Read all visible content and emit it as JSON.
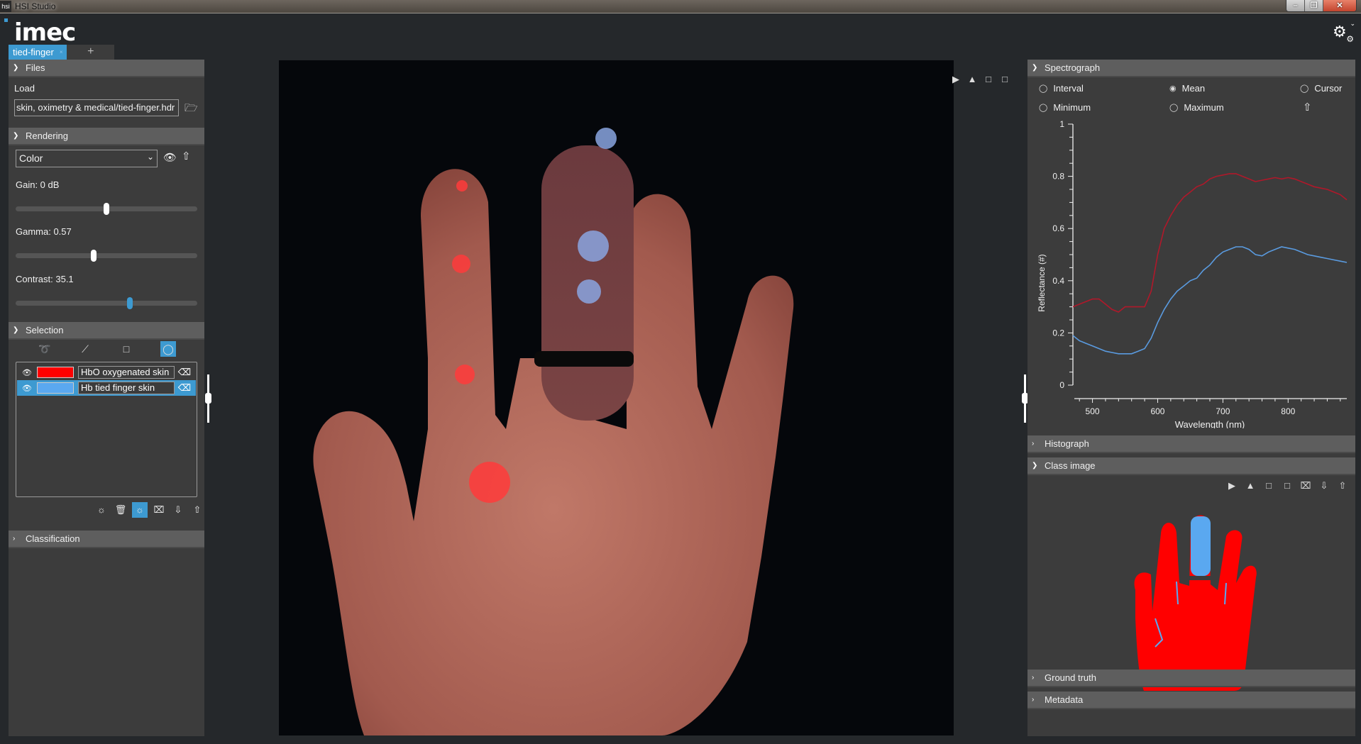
{
  "window": {
    "app_icon": "hsi",
    "title": "HSI Studio",
    "buttons": [
      "minimize",
      "maximize",
      "close"
    ]
  },
  "logo": "imec",
  "tabs": [
    {
      "label": "tied-finger",
      "close": "×",
      "active": true
    }
  ],
  "tab_add": "+",
  "files": {
    "header": "Files",
    "load_label": "Load",
    "path": "skin, oximetry & medical/tied-finger.hdr"
  },
  "rendering": {
    "header": "Rendering",
    "mode": "Color",
    "gain_label": "Gain: 0 dB",
    "gain_fraction": 0.5,
    "gamma_label": "Gamma: 0.57",
    "gamma_fraction": 0.43,
    "contrast_label": "Contrast: 35.1",
    "contrast_fraction": 0.63
  },
  "selection": {
    "header": "Selection",
    "tools": [
      "lasso",
      "line",
      "rectangle",
      "ellipse"
    ],
    "active_tool": "ellipse",
    "classes": [
      {
        "name": "HbO oxygenated skin",
        "color": "#ff0000",
        "visible": true,
        "selected": false
      },
      {
        "name": "Hb tied finger skin",
        "color": "#5aa8f0",
        "visible": true,
        "selected": true
      }
    ],
    "actions": [
      "mask-overlay",
      "delete",
      "mask-overlay-active",
      "clear",
      "import",
      "export"
    ]
  },
  "classification": {
    "header": "Classification"
  },
  "viewer": {
    "tools": [
      "flip-vertical",
      "flip-horizontal",
      "rotate-right",
      "rotate-left"
    ],
    "overlays": {
      "red": "#ff3b3b",
      "blue": "#8aa4e0"
    }
  },
  "spectrograph": {
    "header": "Spectrograph",
    "options": [
      {
        "label": "Interval",
        "visible": false
      },
      {
        "label": "Mean",
        "visible": true
      },
      {
        "label": "Cursor",
        "visible": false
      },
      {
        "label": "Minimum",
        "visible": false
      },
      {
        "label": "Maximum",
        "visible": false
      }
    ]
  },
  "chart_data": {
    "type": "line",
    "title": "",
    "xlabel": "Wavelength (nm)",
    "ylabel": "Reflectance (#)",
    "xlim": [
      470,
      890
    ],
    "ylim": [
      0,
      1
    ],
    "xticks": [
      500,
      600,
      700,
      800
    ],
    "yticks": [
      0,
      0.2,
      0.4,
      0.6,
      0.8,
      1
    ],
    "ytick_labels": [
      "0",
      "0.2",
      "0.4",
      "0.6",
      "0.8",
      "1"
    ],
    "grid": false,
    "x": [
      470,
      480,
      490,
      500,
      510,
      520,
      530,
      540,
      550,
      560,
      570,
      580,
      590,
      600,
      610,
      620,
      630,
      640,
      650,
      660,
      670,
      680,
      690,
      700,
      710,
      720,
      730,
      740,
      750,
      760,
      770,
      780,
      790,
      800,
      810,
      820,
      830,
      840,
      850,
      860,
      870,
      880,
      890
    ],
    "series": [
      {
        "name": "HbO oxygenated skin",
        "color": "#b0182a",
        "values": [
          0.3,
          0.31,
          0.32,
          0.33,
          0.33,
          0.31,
          0.29,
          0.28,
          0.3,
          0.3,
          0.3,
          0.3,
          0.36,
          0.5,
          0.6,
          0.65,
          0.69,
          0.72,
          0.74,
          0.76,
          0.77,
          0.79,
          0.8,
          0.805,
          0.81,
          0.81,
          0.8,
          0.79,
          0.78,
          0.785,
          0.79,
          0.795,
          0.79,
          0.795,
          0.79,
          0.78,
          0.77,
          0.76,
          0.755,
          0.75,
          0.74,
          0.73,
          0.71
        ]
      },
      {
        "name": "Hb tied finger skin",
        "color": "#5a9be0",
        "values": [
          0.19,
          0.17,
          0.16,
          0.15,
          0.14,
          0.13,
          0.125,
          0.12,
          0.12,
          0.12,
          0.13,
          0.14,
          0.18,
          0.24,
          0.29,
          0.33,
          0.36,
          0.38,
          0.4,
          0.41,
          0.44,
          0.46,
          0.49,
          0.51,
          0.52,
          0.53,
          0.53,
          0.52,
          0.5,
          0.495,
          0.51,
          0.52,
          0.53,
          0.525,
          0.52,
          0.51,
          0.5,
          0.495,
          0.49,
          0.485,
          0.48,
          0.475,
          0.47
        ]
      }
    ]
  },
  "histograph": {
    "header": "Histograph"
  },
  "class_image": {
    "header": "Class image",
    "tools": [
      "flip-vertical",
      "flip-horizontal",
      "rotate-right",
      "rotate-left",
      "clear",
      "import",
      "export"
    ]
  },
  "ground_truth": {
    "header": "Ground truth"
  },
  "metadata": {
    "header": "Metadata"
  }
}
